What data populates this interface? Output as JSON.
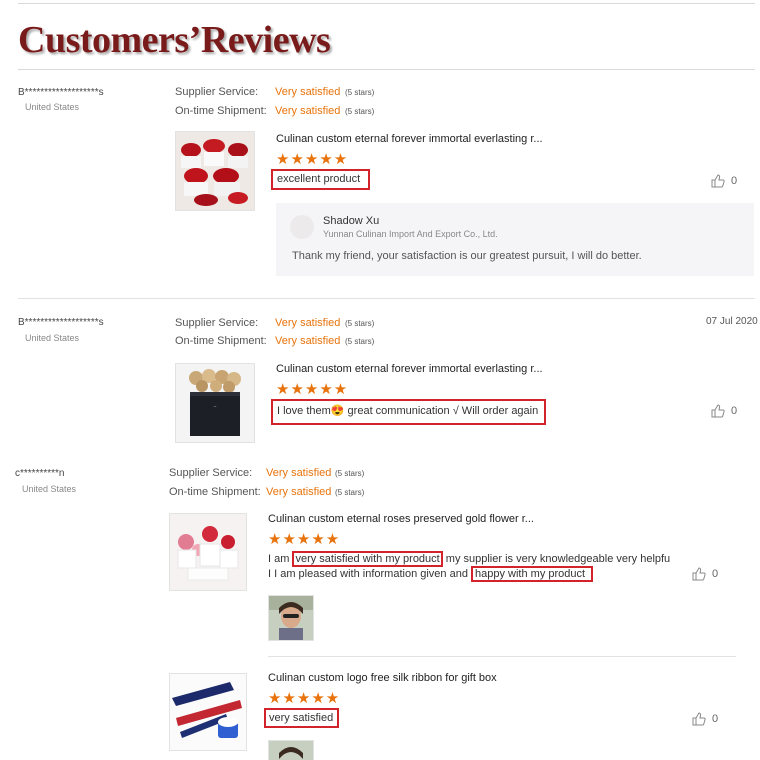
{
  "page": {
    "title": "Customers’Reviews"
  },
  "labels": {
    "supplier_service": "Supplier Service:",
    "on_time_shipment": "On-time Shipment:",
    "very_satisfied": "Very satisfied",
    "five_stars": "(5 stars)"
  },
  "icons": {
    "like": "thumbs-up-icon",
    "stars": "star-rating"
  },
  "colors": {
    "accent_orange": "#e8730c",
    "highlight_red": "#d3232a",
    "title_red": "#7a1b1b"
  },
  "reviews": [
    {
      "user": "B*******************s",
      "country": "United States",
      "date": "",
      "supplier_service_rating": 5,
      "shipment_rating": 5,
      "products": [
        {
          "title": "Culinan custom eternal forever immortal everlasting r...",
          "rating": 5,
          "stars": "★★★★★",
          "comment": "excellent product",
          "likes": "0"
        }
      ],
      "reply": {
        "seller": "Shadow Xu",
        "company": "Yunnan Culinan Import And Export Co., Ltd.",
        "text": "Thank my friend, your satisfaction is our greatest pursuit, I will do better."
      }
    },
    {
      "user": "B*******************s",
      "country": "United States",
      "date": "07 Jul 2020",
      "supplier_service_rating": 5,
      "shipment_rating": 5,
      "products": [
        {
          "title": "Culinan custom eternal forever immortal everlasting r...",
          "rating": 5,
          "stars": "★★★★★",
          "comment": "I love them😍 great communication √ Will order again",
          "likes": "0"
        }
      ]
    },
    {
      "user": "c**********n",
      "country": "United States",
      "date": "",
      "supplier_service_rating": 5,
      "shipment_rating": 5,
      "products": [
        {
          "title": "Culinan custom eternal roses preserved gold flower r...",
          "rating": 5,
          "stars": "★★★★★",
          "comment_line1_pre": "I am ",
          "comment_line1_highlight": "very satisfied with my product",
          "comment_line1_post": " my supplier is very knowledgeable very helpfu",
          "comment_line2_pre": "I I am pleased with information given and ",
          "comment_line2_highlight": "happy with my product",
          "likes": "0"
        },
        {
          "title": "Culinan custom logo free silk ribbon for gift box",
          "rating": 5,
          "stars": "★★★★★",
          "comment": "very satisfied",
          "likes": "0"
        }
      ]
    }
  ]
}
